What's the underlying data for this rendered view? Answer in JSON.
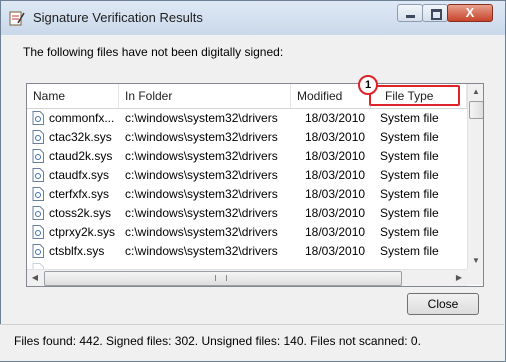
{
  "window": {
    "title": "Signature Verification Results"
  },
  "titlebar_buttons": {
    "close_glyph": "X"
  },
  "description": "The following files have not been digitally signed:",
  "columns": [
    "Name",
    "In Folder",
    "Modified",
    "File Type"
  ],
  "rows": [
    {
      "name": "commonfx...",
      "folder": "c:\\windows\\system32\\drivers",
      "modified": "18/03/2010",
      "type": "System file"
    },
    {
      "name": "ctac32k.sys",
      "folder": "c:\\windows\\system32\\drivers",
      "modified": "18/03/2010",
      "type": "System file"
    },
    {
      "name": "ctaud2k.sys",
      "folder": "c:\\windows\\system32\\drivers",
      "modified": "18/03/2010",
      "type": "System file"
    },
    {
      "name": "ctaudfx.sys",
      "folder": "c:\\windows\\system32\\drivers",
      "modified": "18/03/2010",
      "type": "System file"
    },
    {
      "name": "cterfxfx.sys",
      "folder": "c:\\windows\\system32\\drivers",
      "modified": "18/03/2010",
      "type": "System file"
    },
    {
      "name": "ctoss2k.sys",
      "folder": "c:\\windows\\system32\\drivers",
      "modified": "18/03/2010",
      "type": "System file"
    },
    {
      "name": "ctprxy2k.sys",
      "folder": "c:\\windows\\system32\\drivers",
      "modified": "18/03/2010",
      "type": "System file"
    },
    {
      "name": "ctsblfx.sys",
      "folder": "c:\\windows\\system32\\drivers",
      "modified": "18/03/2010",
      "type": "System file"
    }
  ],
  "callout": {
    "number": "1",
    "color": "#e0222a"
  },
  "close_button": "Close",
  "status": "Files found: 442.  Signed files: 302.  Unsigned files: 140.  Files not scanned: 0."
}
